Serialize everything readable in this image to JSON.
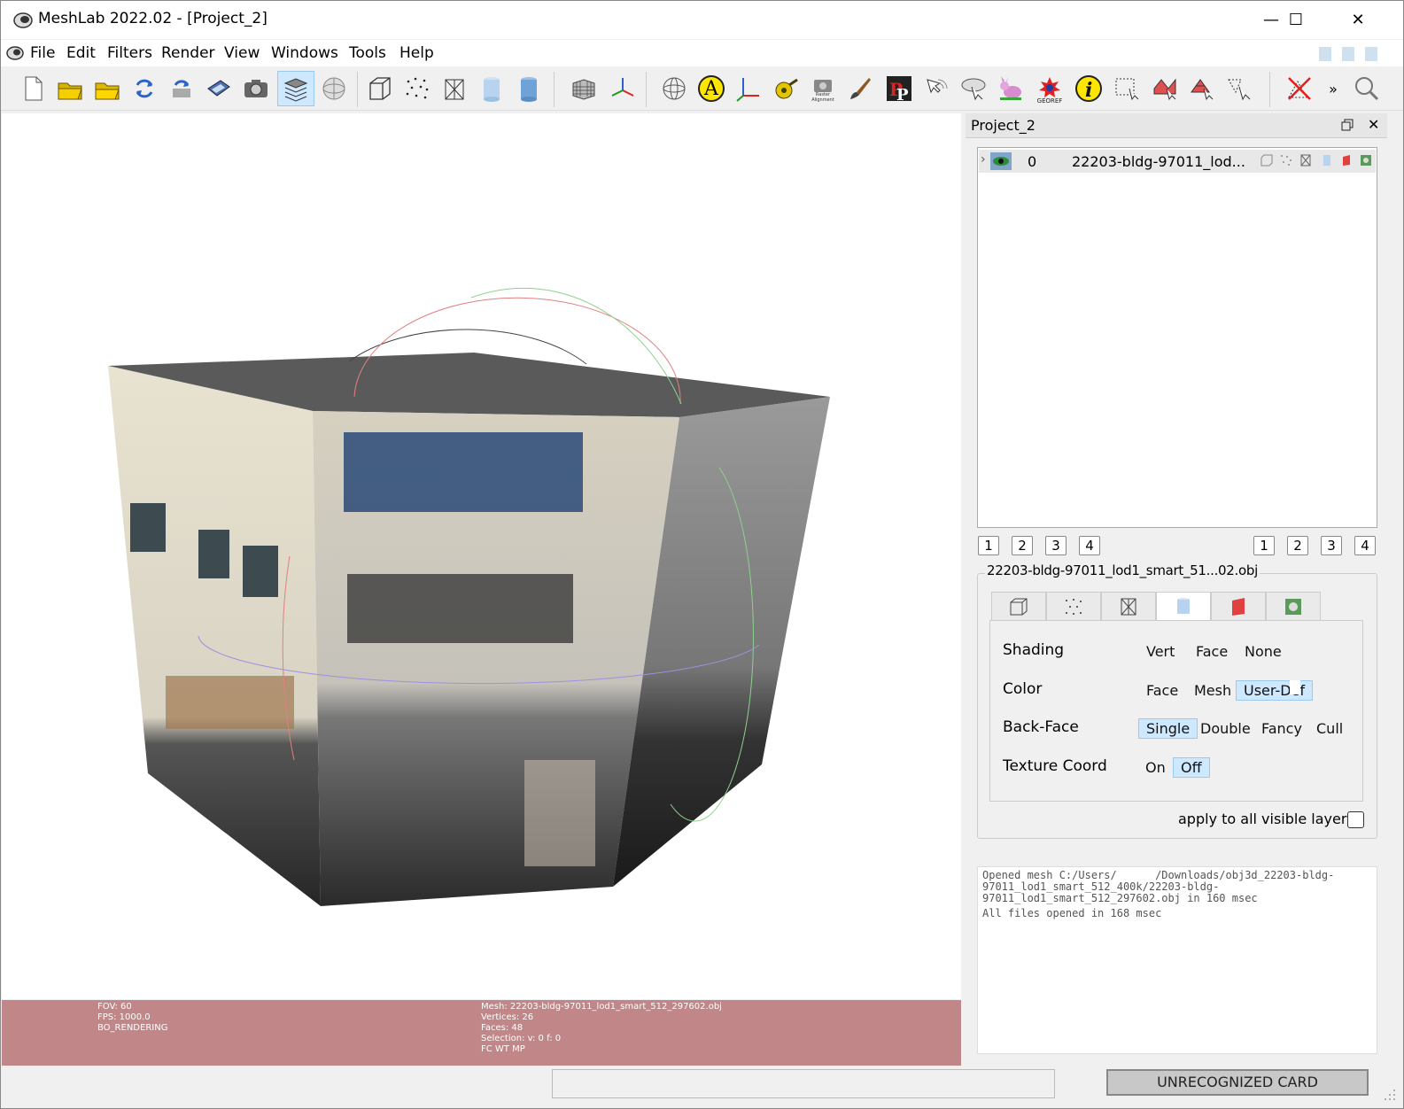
{
  "window": {
    "title": "MeshLab 2022.02 - [Project_2]",
    "minimize": "—",
    "maximize": "☐",
    "close": "✕"
  },
  "menu": [
    "File",
    "Edit",
    "Filters",
    "Render",
    "View",
    "Windows",
    "Tools",
    "Help"
  ],
  "toolbar_icons": [
    "new-project-icon",
    "open-project-icon",
    "import-mesh-icon",
    "reload-icon",
    "reload-all-icon",
    "save-icon",
    "snapshot-icon",
    "layers-icon",
    "sphere-mesh-icon",
    "bbox-icon",
    "points-icon",
    "wireframe-icon",
    "smooth-shading-icon",
    "flat-shading-icon",
    "grid-icon",
    "axes-icon",
    "trackball-icon",
    "annotation-icon",
    "frame-axes-icon",
    "measure-icon",
    "raster-alignment-icon",
    "paint-icon",
    "pickpoints-icon",
    "align-icon",
    "manipulator-icon",
    "bunny-icon",
    "georef-icon",
    "info-icon",
    "select-vertices-icon",
    "select-faces-icon",
    "select-connected-icon",
    "select-region-icon",
    "delete-icon",
    "more-icon",
    "zoom-icon"
  ],
  "toolbar_text": {
    "raster": "Raster\nAlignment",
    "georef": "GEOREF",
    "annotation": "A",
    "more": "»"
  },
  "viewport_info": {
    "left": [
      "FOV: 60",
      "FPS:  1000.0",
      "BO_RENDERING"
    ],
    "right": [
      "Mesh: 22203-bldg-97011_lod1_smart_512_297602.obj",
      "Vertices: 26",
      "Faces: 48",
      "Selection: v: 0 f: 0",
      "FC WT MP"
    ]
  },
  "panel": {
    "title": "Project_2",
    "float_icon": "restore-icon",
    "close": "✕",
    "layer": {
      "index": "0",
      "name": "22203-bldg-97011_lod..."
    },
    "num_buttons_left": [
      "1",
      "2",
      "3",
      "4"
    ],
    "num_buttons_right": [
      "1",
      "2",
      "3",
      "4"
    ],
    "mesh_label": "22203-bldg-97011_lod1_smart_51...02.obj",
    "rows": {
      "shading": {
        "label": "Shading",
        "options": [
          "Vert",
          "Face",
          "None"
        ]
      },
      "color": {
        "label": "Color",
        "options": [
          "Face",
          "Mesh",
          "User-Def"
        ]
      },
      "backface": {
        "label": "Back-Face",
        "options": [
          "Single",
          "Double",
          "Fancy",
          "Cull"
        ]
      },
      "texcoord": {
        "label": "Texture Coord",
        "options": [
          "On",
          "Off"
        ]
      }
    },
    "apply_label": "apply to all visible layers",
    "log": [
      "Opened mesh C:/Users/      /Downloads/obj3d_22203-bldg-97011_lod1_smart_512_400k/22203-bldg-97011_lod1_smart_512_297602.obj in 160 msec",
      "All files opened in 168 msec"
    ]
  },
  "status": {
    "card": "UNRECOGNIZED CARD"
  },
  "colors": {
    "infobar": "#c08688",
    "selected": "#cde8ff"
  }
}
